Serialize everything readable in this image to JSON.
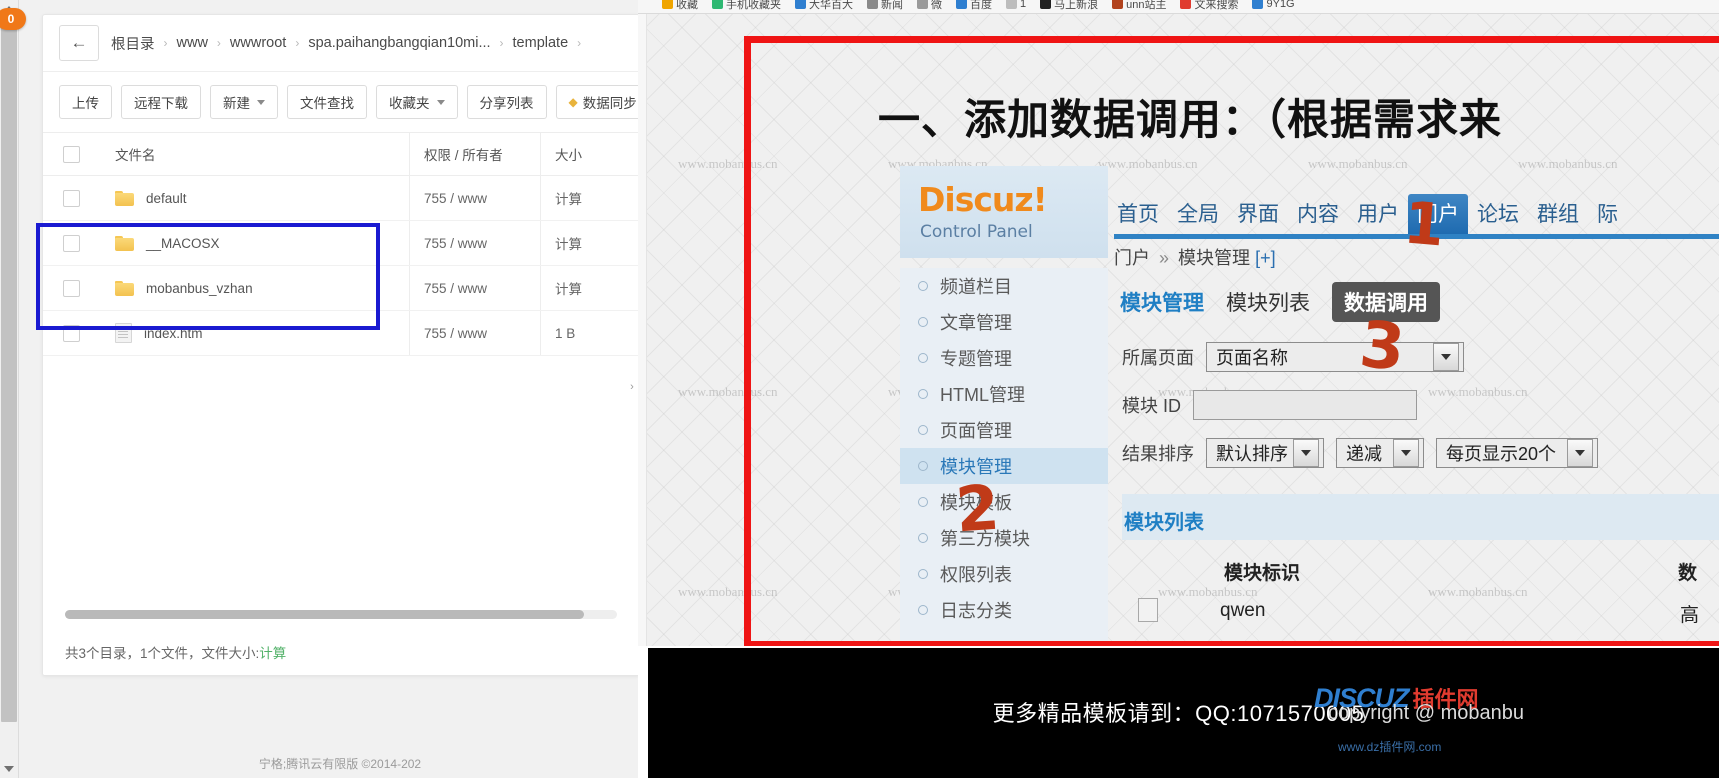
{
  "notification": {
    "badge_count": "0"
  },
  "file_manager": {
    "back_icon": "←",
    "breadcrumb": [
      "根目录",
      "www",
      "wwwroot",
      "spa.paihangbangqian10mi...",
      "template"
    ],
    "breadcrumb_separator": "›",
    "toolbar": [
      {
        "label": "上传",
        "icon": "",
        "caret": false
      },
      {
        "label": "远程下载",
        "icon": "",
        "caret": false
      },
      {
        "label": "新建",
        "icon": "",
        "caret": true
      },
      {
        "label": "文件查找",
        "icon": "",
        "caret": false
      },
      {
        "label": "收藏夹",
        "icon": "",
        "caret": true
      },
      {
        "label": "分享列表",
        "icon": "",
        "caret": false
      },
      {
        "label": "数据同步",
        "icon": "gem-icon",
        "caret": false
      }
    ],
    "columns": [
      "文件名",
      "权限 / 所有者",
      "大小"
    ],
    "rows": [
      {
        "name": "default",
        "type": "folder",
        "perm": "755 / www",
        "size": "计算",
        "size_is_link": true,
        "highlight": false
      },
      {
        "name": "__MACOSX",
        "type": "folder",
        "perm": "755 / www",
        "size": "计算",
        "size_is_link": true,
        "highlight": true
      },
      {
        "name": "mobanbus_vzhan",
        "type": "folder",
        "perm": "755 / www",
        "size": "计算",
        "size_is_link": true,
        "highlight": true
      },
      {
        "name": "index.htm",
        "type": "file",
        "perm": "755 / www",
        "size": "1 B",
        "size_is_link": false,
        "highlight": false
      }
    ],
    "footer_summary_prefix": "共3个目录，1个文件，文件大小: ",
    "footer_summary_link": "计算",
    "collapse_handle_icon": "›",
    "site_footer": "宁格;腾讯云有限版 ©2014-202"
  },
  "viewer": {
    "bookmarks": [
      {
        "label": "收藏",
        "color": "#f0a500"
      },
      {
        "label": "手机收藏夹",
        "color": "#2eb872"
      },
      {
        "label": "大华百大",
        "color": "#2f7fd0"
      },
      {
        "label": "新闻",
        "color": "#8a8a8a"
      },
      {
        "label": "微",
        "color": "#9a9a9a"
      },
      {
        "label": "百度",
        "color": "#2f7fd0"
      },
      {
        "label": "1",
        "color": "#bdbdbd"
      },
      {
        "label": "马上新浪",
        "color": "#222222"
      },
      {
        "label": "unn站主",
        "color": "#b2431e"
      },
      {
        "label": "文来搜索",
        "color": "#e03b2f"
      },
      {
        "label": "9Y1G",
        "color": "#2f7fd0"
      }
    ],
    "heading": "一、添加数据调用：（根据需求来",
    "discuz": {
      "logo": "Discuz!",
      "subtitle": "Control Panel",
      "topnav": [
        "首页",
        "全局",
        "界面",
        "内容",
        "用户",
        "门户",
        "论坛",
        "群组",
        "际"
      ],
      "topnav_active": "门户",
      "breadcrumb_main": "门户",
      "breadcrumb_sep": "»",
      "breadcrumb_sub": "模块管理",
      "breadcrumb_plus": "[+]",
      "sidebar": [
        "频道栏目",
        "文章管理",
        "专题管理",
        "HTML管理",
        "页面管理",
        "模块管理",
        "模块模板",
        "第三方模块",
        "权限列表",
        "日志分类"
      ],
      "sidebar_active": "模块管理",
      "module_tabs": [
        {
          "label": "模块管理",
          "style": "current"
        },
        {
          "label": "模块列表",
          "style": "plain"
        },
        {
          "label": "数据调用",
          "style": "chip"
        }
      ],
      "form": {
        "page_label": "所属页面",
        "page_value": "页面名称",
        "module_id_label": "模块 ID",
        "module_id_value": "",
        "sort_label": "结果排序",
        "sort_value": "默认排序",
        "order_value": "递减",
        "perpage_value": "每页显示20个"
      },
      "module_list_title": "模块列表",
      "table_headers": {
        "identifier": "模块标识",
        "count": "数"
      },
      "table_row": {
        "name": "qwen",
        "count": "高"
      }
    },
    "annotations": [
      {
        "id": "1",
        "text": "1"
      },
      {
        "id": "2",
        "text": "2"
      },
      {
        "id": "3",
        "text": "3"
      }
    ],
    "watermark_text": "www.mobanbus.cn",
    "bottom_bar": {
      "promo": "更多精品模板请到：QQ:1071570005",
      "copyright": "copyright @ mobanbu",
      "brand_left": "DISCUZ",
      "brand_right": "插件网",
      "url": "www.dz插件网.com"
    },
    "colors": {
      "annotation_red": "#ef1414",
      "annotation_orange": "#c03a18",
      "highlight_blue": "#1a1ad1",
      "discuz_orange": "#f08a1c",
      "discuz_blue": "#2f82c4",
      "link_green": "#53b26a"
    }
  }
}
